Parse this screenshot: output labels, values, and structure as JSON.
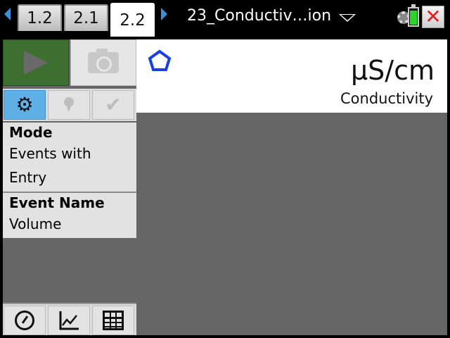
{
  "tabs": [
    "1.2",
    "2.1",
    "2.2"
  ],
  "active_tab": "2.2",
  "document": {
    "title": "23_Conductiv…ion"
  },
  "battery": {
    "level": 0.85,
    "color": "#2bd42b"
  },
  "sidebar": {
    "start_icon": "play-icon",
    "snapshot_icon": "camera-icon",
    "tools": [
      "gear-icon",
      "marker-icon",
      "check-icon"
    ],
    "mode_header": "Mode",
    "mode_value_line1": "Events with",
    "mode_value_line2": "Entry",
    "event_header": "Event Name",
    "event_value": "Volume",
    "views": [
      "meter-icon",
      "graph-icon",
      "table-icon"
    ]
  },
  "meter": {
    "unit": "μS/cm",
    "quantity": "Conductivity",
    "sensor_icon": "pentagon-icon",
    "sensor_color": "#1a3fe0"
  },
  "colors": {
    "accent": "#3a8fd8",
    "start_green": "#3c6f30",
    "close_red": "#d22222"
  }
}
